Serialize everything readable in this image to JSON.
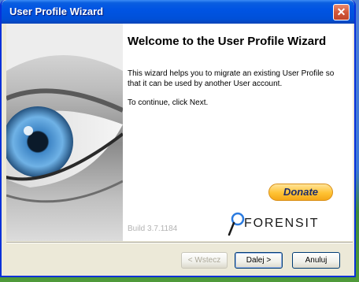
{
  "window": {
    "title": "User Profile Wizard",
    "close_symbol": "✕"
  },
  "welcome": {
    "heading": "Welcome to the User Profile Wizard",
    "description": "This wizard helps you to migrate an existing User Profile so that it can be used by another User account.",
    "instruction": "To continue, click Next."
  },
  "donate": {
    "label": "Donate"
  },
  "build": {
    "label": "Build 3.7.1184"
  },
  "logo": {
    "text": "FORENSIT"
  },
  "buttons": {
    "back": "< Wstecz",
    "next": "Dalej >",
    "cancel": "Anuluj"
  },
  "icons": {
    "close": "close-icon",
    "logo_mark": "forensit-logo-icon",
    "eye": "eye-image"
  }
}
